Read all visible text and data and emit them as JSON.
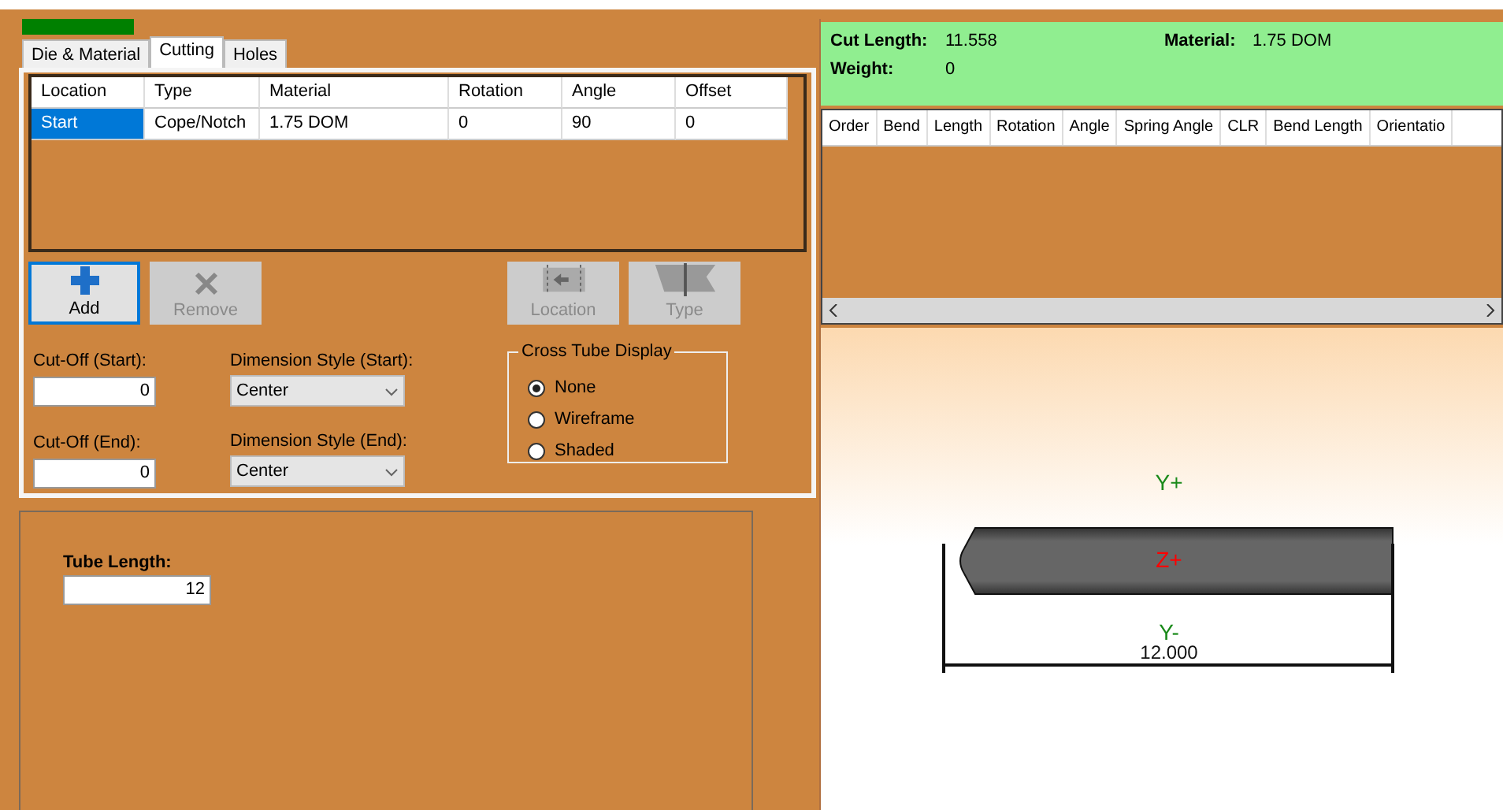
{
  "tabs": [
    {
      "label": "Die & Material",
      "selected": false
    },
    {
      "label": "Cutting",
      "selected": true
    },
    {
      "label": "Holes",
      "selected": false
    }
  ],
  "cuts_table": {
    "columns": [
      "Location",
      "Type",
      "Material",
      "Rotation",
      "Angle",
      "Offset"
    ],
    "rows": [
      {
        "cells": [
          {
            "text": "Start",
            "selected": true
          },
          {
            "text": "Cope/Notch",
            "selected": false
          },
          {
            "text": "1.75 DOM",
            "selected": false
          },
          {
            "text": "0",
            "selected": false
          },
          {
            "text": "90",
            "selected": false
          },
          {
            "text": "0",
            "selected": false
          }
        ]
      }
    ]
  },
  "buttons": [
    {
      "label": "Add",
      "kind": "add",
      "disabled": false,
      "selected": true
    },
    {
      "label": "Remove",
      "kind": "remove",
      "disabled": true,
      "selected": false
    },
    {
      "label": "Location",
      "kind": "location",
      "disabled": true,
      "selected": false
    },
    {
      "label": "Type",
      "kind": "type",
      "disabled": true,
      "selected": false
    }
  ],
  "cut_off_start": {
    "label": "Cut-Off (Start):",
    "value": "0"
  },
  "cut_off_end": {
    "label": "Cut-Off (End):",
    "value": "0"
  },
  "dimension_style_start": {
    "label": "Dimension Style (Start):",
    "value": "Center"
  },
  "dimension_style_end": {
    "label": "Dimension Style (End):",
    "value": "Center"
  },
  "cross_tube_display": {
    "title": "Cross Tube Display",
    "options": [
      {
        "label": "None",
        "selected": true
      },
      {
        "label": "Wireframe",
        "selected": false
      },
      {
        "label": "Shaded",
        "selected": false
      }
    ]
  },
  "tube_length": {
    "label": "Tube Length:",
    "value": "12"
  },
  "summary": {
    "cut_length_label": "Cut Length:",
    "cut_length": "11.558",
    "material_label": "Material:",
    "material": "1.75 DOM",
    "weight_label": "Weight:",
    "weight": "0"
  },
  "bends_table": {
    "columns": [
      "Order",
      "Bend",
      "Length",
      "Rotation",
      "Angle",
      "Spring Angle",
      "CLR",
      "Bend Length",
      "Orientatio"
    ]
  },
  "viewer": {
    "y_plus": "Y+",
    "z_plus": "Z+",
    "y_minus": "Y-",
    "dimension": "12.000"
  }
}
